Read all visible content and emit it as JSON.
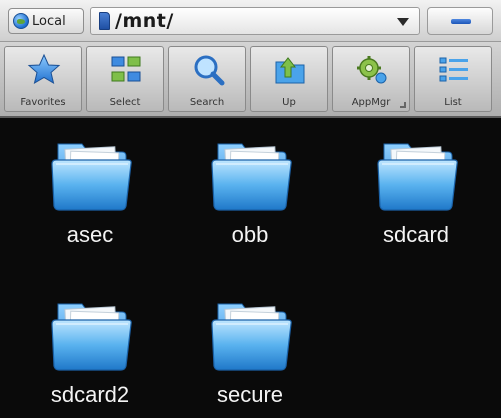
{
  "location": {
    "local_label": "Local",
    "path": "/mnt/"
  },
  "toolbar": {
    "items": [
      {
        "label": "Favorites",
        "icon": "star-icon"
      },
      {
        "label": "Select",
        "icon": "select-grid-icon"
      },
      {
        "label": "Search",
        "icon": "magnifier-icon"
      },
      {
        "label": "Up",
        "icon": "folder-up-icon"
      },
      {
        "label": "AppMgr",
        "icon": "gear-icon"
      },
      {
        "label": "List",
        "icon": "list-icon"
      }
    ]
  },
  "files": [
    {
      "name": "asec",
      "type": "folder"
    },
    {
      "name": "obb",
      "type": "folder"
    },
    {
      "name": "sdcard",
      "type": "folder"
    },
    {
      "name": "sdcard2",
      "type": "folder"
    },
    {
      "name": "secure",
      "type": "folder"
    }
  ],
  "colors": {
    "background": "#0a0a0a",
    "folder_blue": "#4aa3ea",
    "accent_blue": "#1c56b8"
  }
}
